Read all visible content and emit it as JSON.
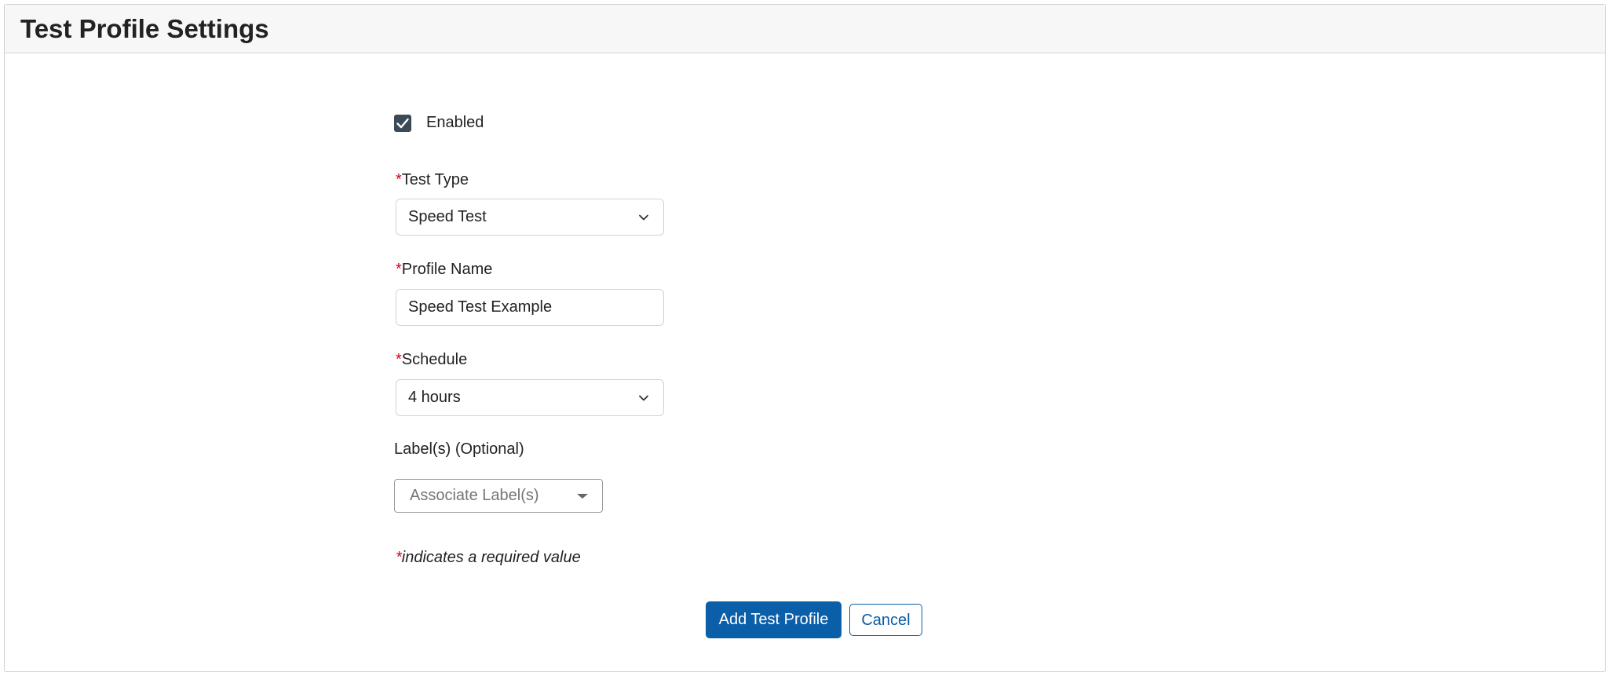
{
  "page": {
    "title": "Test Profile Settings"
  },
  "form": {
    "enabled": {
      "label": "Enabled",
      "checked": true
    },
    "test_type": {
      "required_mark": "*",
      "label": "Test Type",
      "value": "Speed Test"
    },
    "profile_name": {
      "required_mark": "*",
      "label": "Profile Name",
      "value": "Speed Test Example"
    },
    "schedule": {
      "required_mark": "*",
      "label": "Schedule",
      "value": "4 hours"
    },
    "labels": {
      "label": "Label(s) (Optional)",
      "placeholder": "Associate Label(s)"
    },
    "required_note": {
      "mark": "*",
      "text": "indicates a required value"
    }
  },
  "actions": {
    "submit_label": "Add Test Profile",
    "cancel_label": "Cancel"
  },
  "colors": {
    "primary": "#0b5ea8",
    "required": "#d0021b",
    "checkbox": "#3b4a56"
  },
  "icons": {
    "checkbox": "check-icon",
    "select_arrow": "chevron-down-icon",
    "picker_arrow": "caret-down-icon"
  }
}
